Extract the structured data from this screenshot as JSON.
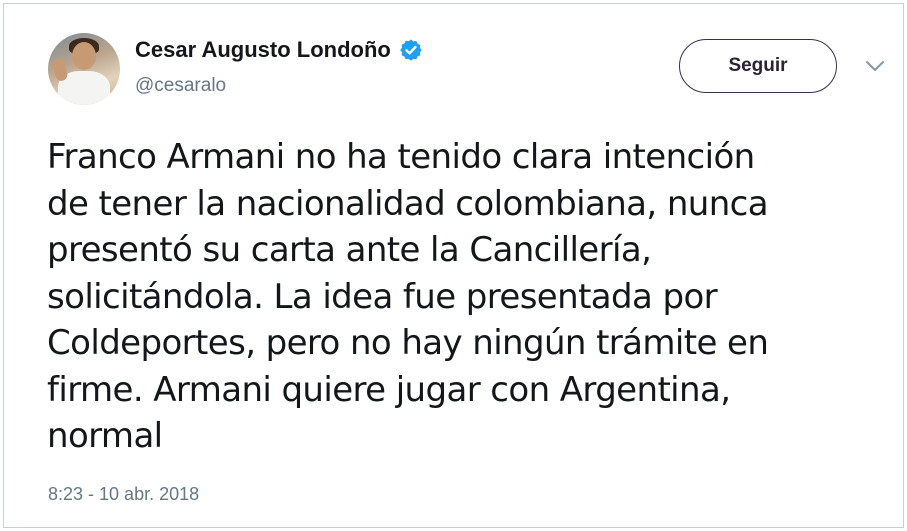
{
  "tweet": {
    "author_name": "Cesar Augusto Londoño",
    "author_handle": "@cesaralo",
    "verified": true,
    "follow_label": "Seguir",
    "text": "Franco Armani no ha tenido clara intención\nde tener la nacionalidad colombiana, nunca\npresentó su carta ante la Cancillería,\nsolicitándola. La idea fue presentada por\nColdeportes, pero no hay ningún trámite en\nfirme. Armani quiere jugar con Argentina,\nnormal",
    "timestamp": "8:23 - 10 abr. 2018"
  },
  "icons": {
    "verified": "verified-badge-icon",
    "menu": "chevron-down-icon"
  },
  "colors": {
    "verified_blue": "#1da1f2",
    "secondary_text": "#657786",
    "primary_text": "#14171a",
    "follow_border": "#3b2f4a"
  }
}
